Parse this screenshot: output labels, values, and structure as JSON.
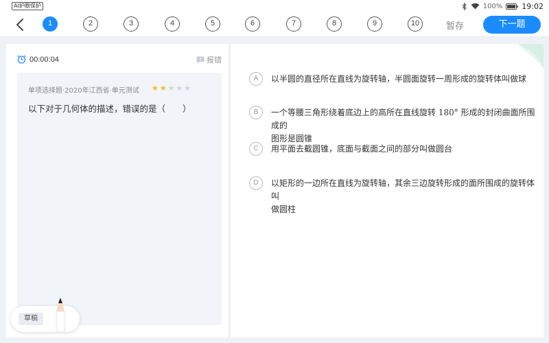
{
  "status_bar": {
    "ai_badge": "AI护眼保护",
    "battery": "100%",
    "time": "19:02"
  },
  "nav": {
    "questions": [
      "1",
      "2",
      "3",
      "4",
      "5",
      "6",
      "7",
      "8",
      "9",
      "10"
    ],
    "active_index": 0,
    "save_label": "暂存",
    "next_label": "下一题"
  },
  "colors": {
    "accent": "#1a8cff",
    "star_on": "#f5b81c",
    "card_bg": "#f1f5fa"
  },
  "left_panel": {
    "timer": "00:00:04",
    "report_label": "报错",
    "question": {
      "meta": "单项选择题·2020年江西省·单元测试",
      "difficulty_stars": 2,
      "max_stars": 5,
      "text": "以下对于几何体的描述，错误的是（　　）"
    },
    "draft_label": "草稿"
  },
  "options": [
    {
      "letter": "A",
      "lines": [
        "以半圆的直径所在直线为旋转轴，半圆面旋转一周形成的旋转体叫做球"
      ]
    },
    {
      "letter": "B",
      "pre": "一个等腰三角形绕着底边上的高所在直线旋转 ",
      "math": "180°",
      "post": " 形成的封闭曲面所围成的",
      "line2": "图形是圆锥"
    },
    {
      "letter": "C",
      "lines": [
        "用平面去截圆锥，底面与截面之间的部分叫做圆台"
      ]
    },
    {
      "letter": "D",
      "lines": [
        "以矩形的一边所在直线为旋转轴，其余三边旋转形成的面所围成的旋转体叫",
        "做圆柱"
      ]
    }
  ]
}
